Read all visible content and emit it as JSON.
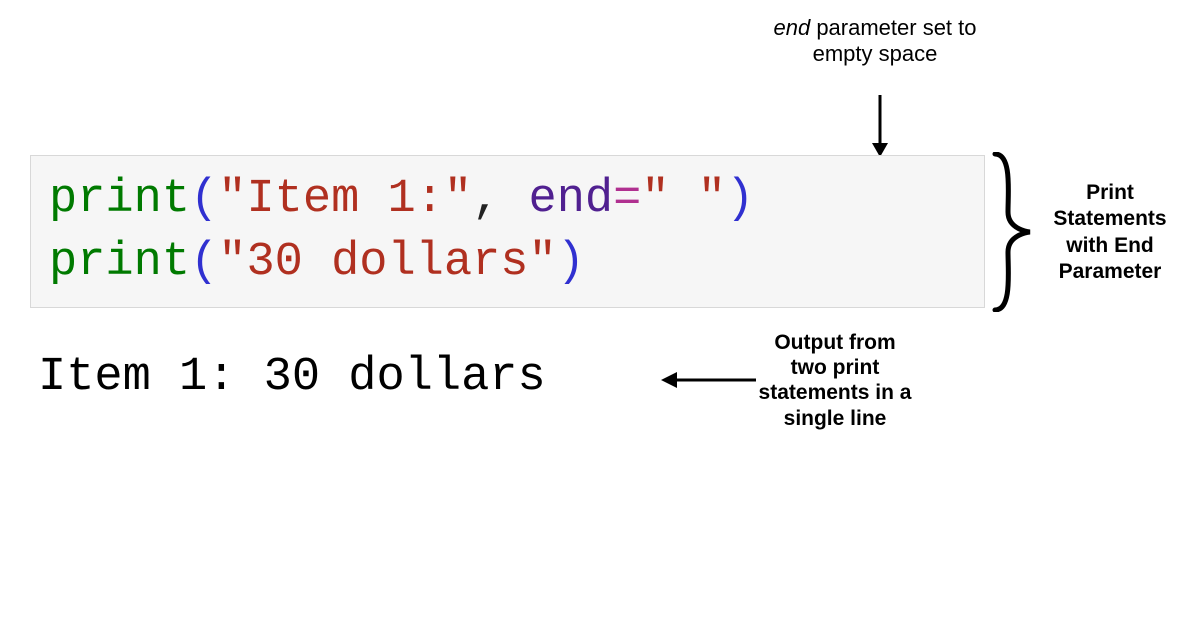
{
  "annotations": {
    "top": {
      "italic_word": "end",
      "rest": " parameter set to empty space"
    },
    "brace_label": "Print Statements with End Parameter",
    "output_label": "Output from two print statements in a single line"
  },
  "code": {
    "line1": {
      "fn": "print",
      "paren_open": "(",
      "str1": "\"Item 1:\"",
      "comma_space": ", ",
      "kw": "end",
      "eq": "=",
      "str2": "\" \"",
      "paren_close": ")"
    },
    "line2": {
      "fn": "print",
      "paren_open": "(",
      "str": "\"30 dollars\"",
      "paren_close": ")"
    }
  },
  "output_text": "Item 1: 30 dollars"
}
